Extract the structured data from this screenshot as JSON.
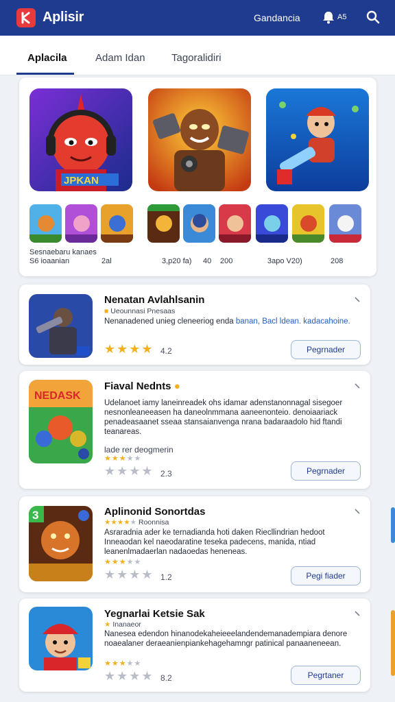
{
  "header": {
    "brand": "Aplisir",
    "link": "Gandancia",
    "notif_count": "A5",
    "colors": {
      "bar": "#1f3b8f",
      "logo": "#e8393c"
    }
  },
  "tabs": [
    {
      "label": "Aplacila"
    },
    {
      "label": "Adam Idan"
    },
    {
      "label": "Tagoralidiri"
    }
  ],
  "featured": {
    "caption1": "Sesnaebaru kanaes",
    "caption2": "S6 ioaanian",
    "num1": "2al",
    "num2": "3,p20 fa)",
    "num3": "40",
    "num4": "200",
    "num5": "3apo V20)",
    "num6": "208"
  },
  "apps": [
    {
      "title": "Nenatan Avlahlsanin",
      "subtitle": "Ueounnasi Pnesaas",
      "desc_a": "Nenanadened unieg cleneeriog enda",
      "desc_link": "banan, Bacl ldean. kadacahoine.",
      "rating": "4.2",
      "button": "Pegrnader"
    },
    {
      "title": "Fiaval Nednts",
      "desc": "Udelanoet iamy laneinreadek ohs idamar adenstanonnagal sisegoer nesnonleaneeasen ha daneolnmmana aaneenonteio. denoiaariack penadeasaanet sseaa stansaianvenga nrana badaraadolo hid ftandi teanareas.",
      "sub": "lade rer deogmerin",
      "rating": "2.3",
      "button": "Pegrnader"
    },
    {
      "title": "Aplinonid Sonortdas",
      "subtitle": "Roonnisa",
      "desc": "Asraradnia ader ke ternadianda hoti daken Riecllindrian hedoot Inneaodan kel naeodaratine teseka padecens, manida, ntiad leanenlmadaerlan nadaoedas heneneas.",
      "rating": "1.2",
      "button": "Pegi fiader"
    },
    {
      "title": "Yegnarlai Ketsie Sak",
      "subtitle": "Inanaeor",
      "desc": "Nanesea edendon hinanodekaheieeelandendemanadempiara denore noaealaner deraeanienpiankehagehamngr patinical panaaneneean.",
      "rating": "8.2",
      "button": "Pegrtaner"
    }
  ]
}
